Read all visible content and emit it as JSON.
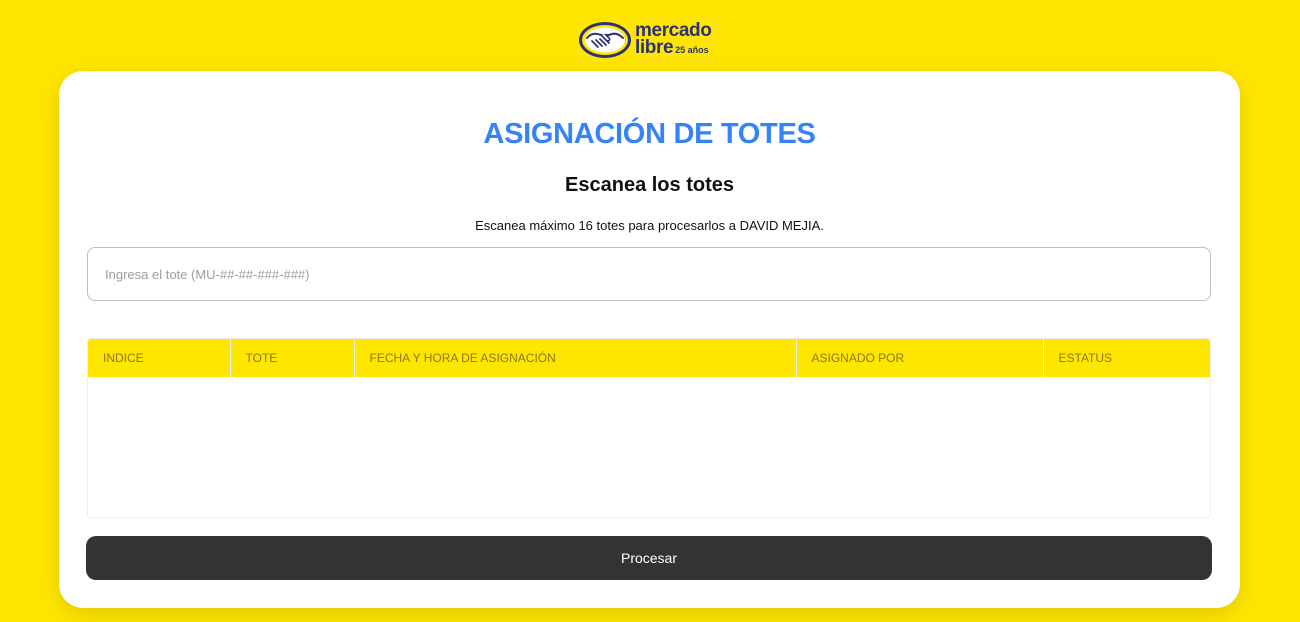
{
  "brand": {
    "line1": "mercado",
    "line2": "libre",
    "anniversary": "25 años",
    "logo_icon": "handshake-icon",
    "colors": {
      "navy": "#2D3277",
      "yellow": "#FFE600"
    }
  },
  "page": {
    "title": "ASIGNACIÓN DE TOTES",
    "subtitle": "Escanea los totes",
    "description": "Escanea máximo 16 totes para procesarlos a DAVID MEJIA."
  },
  "tote_input": {
    "placeholder": "Ingresa el tote (MU-##-##-###-###)",
    "value": ""
  },
  "table": {
    "columns": [
      "INDICE",
      "TOTE",
      "FECHA Y HORA DE ASIGNACIÓN",
      "ASIGNADO POR",
      "ESTATUS"
    ],
    "rows": []
  },
  "actions": {
    "process_label": "Procesar"
  },
  "colors": {
    "background": "#FFE600",
    "title": "#3483FA",
    "button": "#333333",
    "header_text": "#8A7A12"
  }
}
